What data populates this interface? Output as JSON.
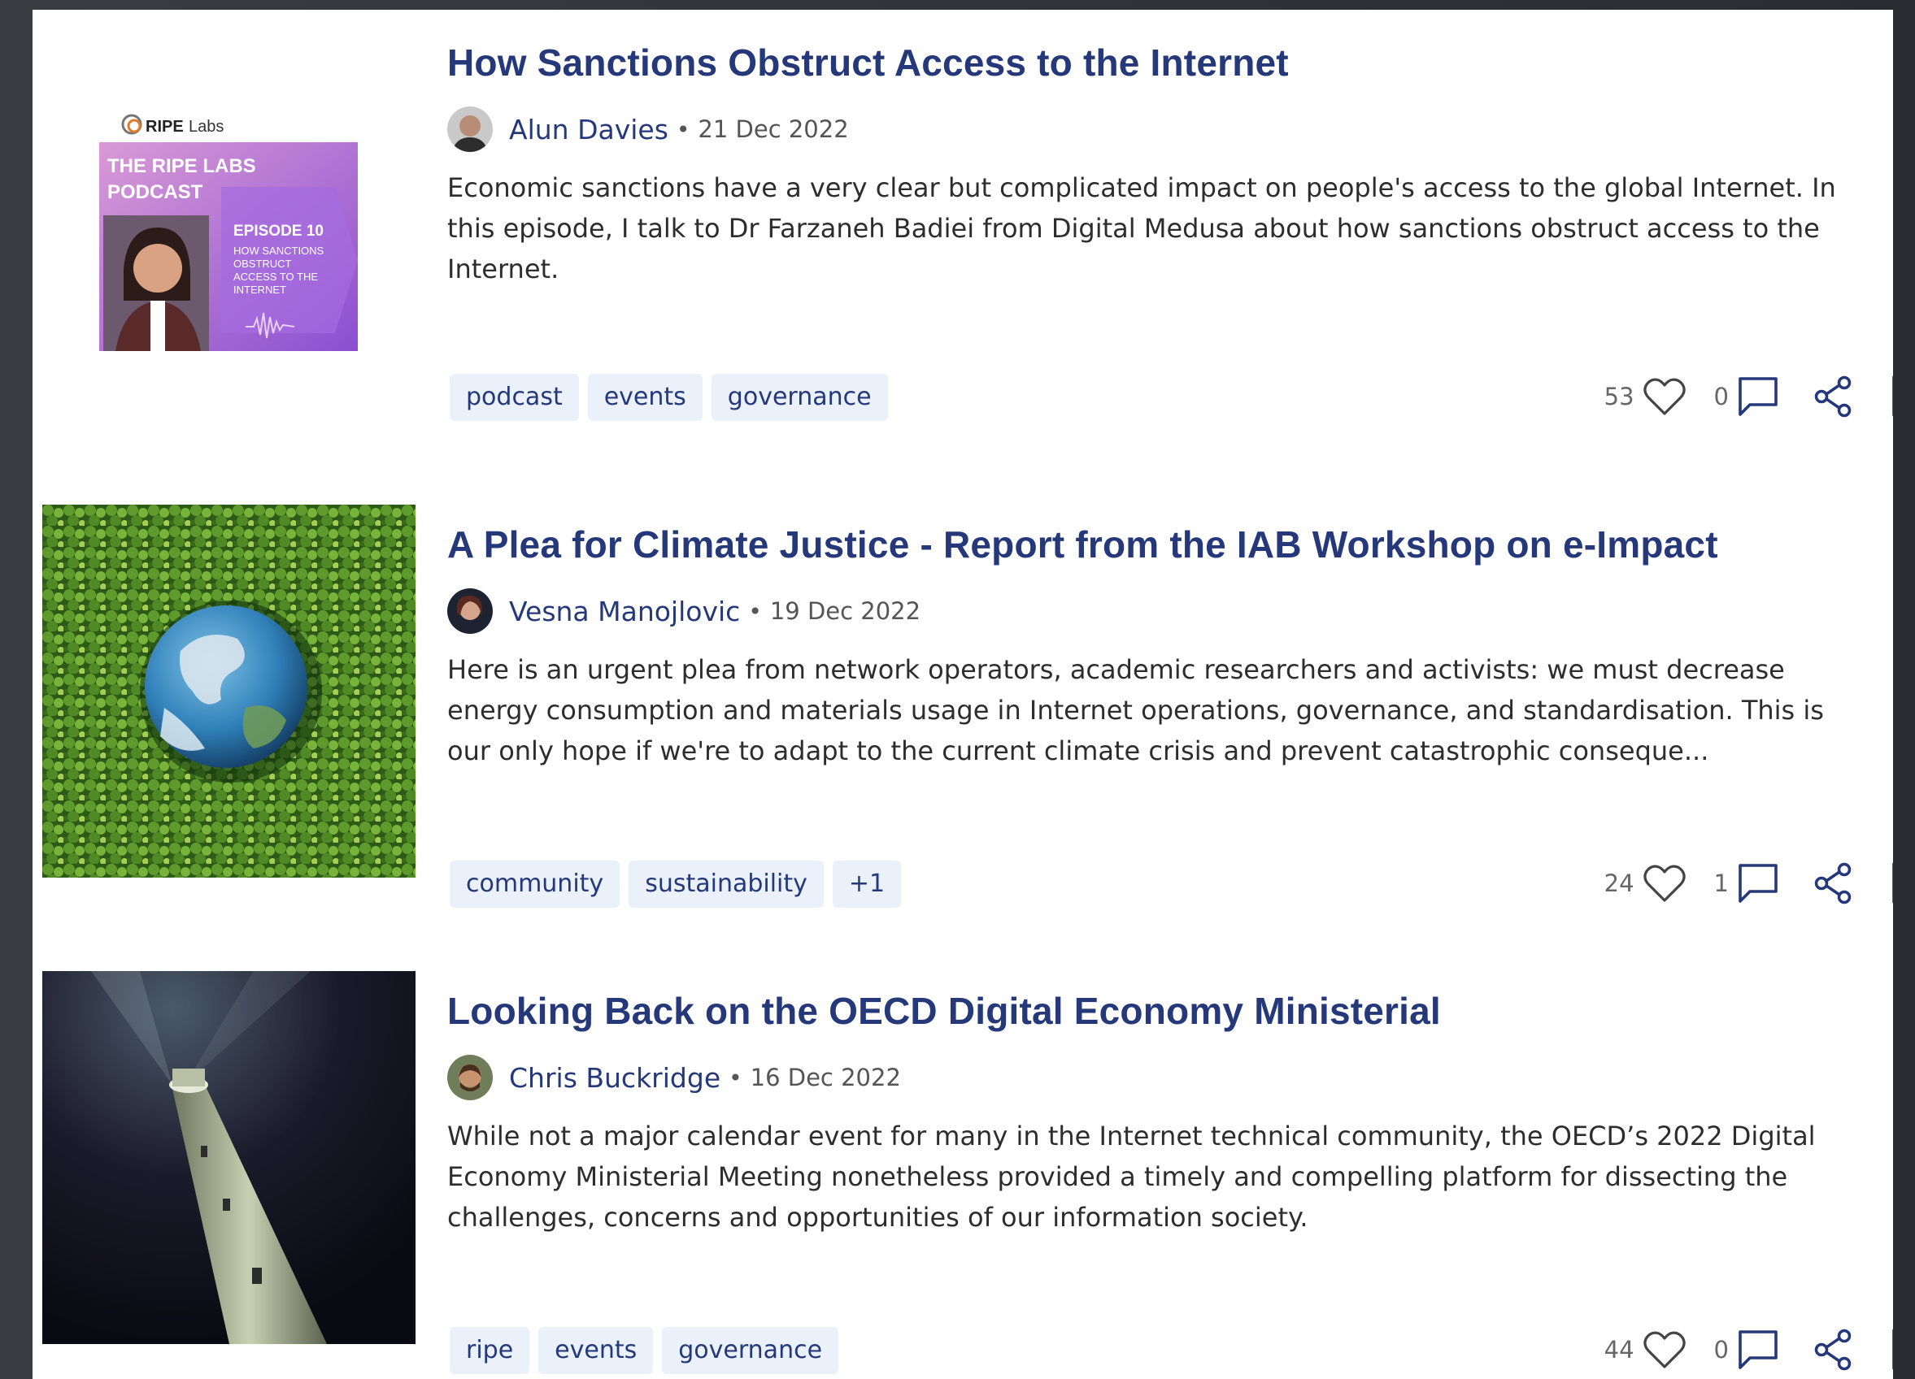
{
  "articles": [
    {
      "title": "How Sanctions Obstruct Access to the Internet",
      "author": "Alun Davies",
      "date": "21 Dec 2022",
      "summary": "Economic sanctions have a very clear but complicated impact on people's access to the global Internet. In this episode, I talk to Dr Farzaneh Badiei from Digital Medusa about how sanctions obstruct access to the Internet.",
      "tags": [
        "podcast",
        "events",
        "governance"
      ],
      "likes": "53",
      "comments": "0",
      "thumb": {
        "brand": "RIPE",
        "brand_suffix": "Labs",
        "line1": "THE RIPE LABS",
        "line2": "PODCAST",
        "episode": "EPISODE 10",
        "subtitle": [
          "HOW SANCTIONS",
          "OBSTRUCT",
          "ACCESS TO THE",
          "INTERNET"
        ]
      }
    },
    {
      "title": "A Plea for Climate Justice - Report from the IAB Workshop on e-Impact",
      "author": "Vesna Manojlovic",
      "date": "19 Dec 2022",
      "summary": "Here is an urgent plea from network operators, academic researchers and activists: we must decrease energy consumption and materials usage in Internet operations, governance, and standardisation. This is our only hope if we're to adapt to the current climate crisis and prevent catastrophic conseque...",
      "tags": [
        "community",
        "sustainability",
        "+1"
      ],
      "likes": "24",
      "comments": "1"
    },
    {
      "title": "Looking Back on the OECD Digital Economy Ministerial",
      "author": "Chris Buckridge",
      "date": "16 Dec 2022",
      "summary": "While not a major calendar event for many in the Internet technical community, the OECD’s 2022 Digital Economy Ministerial Meeting nonetheless provided a timely and compelling platform for dissecting the challenges, concerns and opportunities of our information society.",
      "tags": [
        "ripe",
        "events",
        "governance"
      ],
      "likes": "44",
      "comments": "0"
    }
  ],
  "separator": "•",
  "colors": {
    "link": "#24387a",
    "tag_bg": "#eaf1fa",
    "text": "#2d2d2d"
  },
  "icons": [
    "heart-icon",
    "comment-icon",
    "share-icon",
    "bookmark-icon"
  ]
}
